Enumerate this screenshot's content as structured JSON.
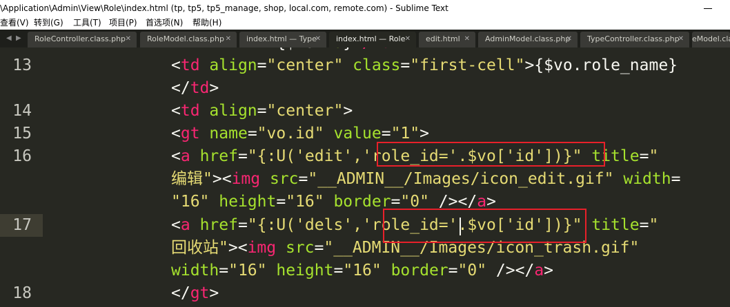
{
  "window": {
    "title": "\\Application\\Admin\\View\\Role\\index.html (tp, tp5, tp5_manage, shop, local.com, remote.com) - Sublime Text"
  },
  "menu": [
    "查看(V)",
    "转到(G)",
    "工具(T)",
    "项目(P)",
    "首选项(N)",
    "帮助(H)"
  ],
  "tabs": [
    {
      "label": "RoleController.class.php",
      "active": false
    },
    {
      "label": "RoleModel.class.php",
      "active": false
    },
    {
      "label": "index.html — Type",
      "active": false
    },
    {
      "label": "index.html — Role",
      "active": true
    },
    {
      "label": "edit.html",
      "active": false
    },
    {
      "label": "AdminModel.class.php",
      "active": false
    },
    {
      "label": "TypeController.class.php",
      "active": false
    },
    {
      "label": "eModel.cla",
      "active": false
    }
  ],
  "editor": {
    "line_numbers": [
      "13",
      "14",
      "15",
      "16",
      "17",
      "18"
    ],
    "current_line": "17",
    "lines": [
      [
        [
          "tg",
          "      <"
        ],
        [
          "tg",
          "tr"
        ],
        [
          "pl",
          "> {$vo."
        ],
        [
          "at",
          "id"
        ],
        [
          "pl",
          "}"
        ],
        [
          "tg",
          "</"
        ],
        [
          "tg",
          "td"
        ],
        [
          "pl",
          ">"
        ]
      ],
      [
        [
          "pl",
          "<"
        ],
        [
          "tg",
          "td"
        ],
        [
          "pl",
          " "
        ],
        [
          "at",
          "align"
        ],
        [
          "pl",
          "="
        ],
        [
          "st",
          "\"center\""
        ],
        [
          "pl",
          " "
        ],
        [
          "at",
          "class"
        ],
        [
          "pl",
          "="
        ],
        [
          "st",
          "\"first-cell\""
        ],
        [
          "pl",
          ">{$vo.role_name}"
        ]
      ],
      [
        [
          "pl",
          "</"
        ],
        [
          "tg",
          "td"
        ],
        [
          "pl",
          ">"
        ]
      ],
      [
        [
          "pl",
          "<"
        ],
        [
          "tg",
          "td"
        ],
        [
          "pl",
          " "
        ],
        [
          "at",
          "align"
        ],
        [
          "pl",
          "="
        ],
        [
          "st",
          "\"center\""
        ],
        [
          "pl",
          ">"
        ]
      ],
      [
        [
          "pl",
          "<"
        ],
        [
          "tg",
          "gt"
        ],
        [
          "pl",
          " "
        ],
        [
          "at",
          "name"
        ],
        [
          "pl",
          "="
        ],
        [
          "st",
          "\"vo.id\""
        ],
        [
          "pl",
          " "
        ],
        [
          "at",
          "value"
        ],
        [
          "pl",
          "="
        ],
        [
          "st",
          "\"1\""
        ],
        [
          "pl",
          ">"
        ]
      ],
      [
        [
          "pl",
          "<"
        ],
        [
          "tg",
          "a"
        ],
        [
          "pl",
          " "
        ],
        [
          "at",
          "href"
        ],
        [
          "pl",
          "="
        ],
        [
          "st",
          "\"{:U('edit','role_id='.$vo['id'])}\""
        ],
        [
          "pl",
          " "
        ],
        [
          "at",
          "title"
        ],
        [
          "pl",
          "="
        ],
        [
          "st",
          "\""
        ]
      ],
      [
        [
          "st",
          "编辑\""
        ],
        [
          "pl",
          "><"
        ],
        [
          "tg",
          "img"
        ],
        [
          "pl",
          " "
        ],
        [
          "at",
          "src"
        ],
        [
          "pl",
          "="
        ],
        [
          "st",
          "\"__ADMIN__/Images/icon_edit.gif\""
        ],
        [
          "pl",
          " "
        ],
        [
          "at",
          "width"
        ],
        [
          "pl",
          "="
        ]
      ],
      [
        [
          "st",
          "\"16\""
        ],
        [
          "pl",
          " "
        ],
        [
          "at",
          "height"
        ],
        [
          "pl",
          "="
        ],
        [
          "st",
          "\"16\""
        ],
        [
          "pl",
          " "
        ],
        [
          "at",
          "border"
        ],
        [
          "pl",
          "="
        ],
        [
          "st",
          "\"0\""
        ],
        [
          "pl",
          " /></"
        ],
        [
          "tg",
          "a"
        ],
        [
          "pl",
          ">"
        ]
      ],
      [
        [
          "pl",
          "<"
        ],
        [
          "tg",
          "a"
        ],
        [
          "pl",
          " "
        ],
        [
          "at",
          "href"
        ],
        [
          "pl",
          "="
        ],
        [
          "st",
          "\"{:U('dels','role_id='.$vo['id'])}\""
        ],
        [
          "pl",
          " "
        ],
        [
          "at",
          "title"
        ],
        [
          "pl",
          "="
        ],
        [
          "st",
          "\""
        ]
      ],
      [
        [
          "st",
          "回收站\""
        ],
        [
          "pl",
          "><"
        ],
        [
          "tg",
          "img"
        ],
        [
          "pl",
          " "
        ],
        [
          "at",
          "src"
        ],
        [
          "pl",
          "="
        ],
        [
          "st",
          "\"__ADMIN__/Images/icon_trash.gif\""
        ]
      ],
      [
        [
          "at",
          "width"
        ],
        [
          "pl",
          "="
        ],
        [
          "st",
          "\"16\""
        ],
        [
          "pl",
          " "
        ],
        [
          "at",
          "height"
        ],
        [
          "pl",
          "="
        ],
        [
          "st",
          "\"16\""
        ],
        [
          "pl",
          " "
        ],
        [
          "at",
          "border"
        ],
        [
          "pl",
          "="
        ],
        [
          "st",
          "\"0\""
        ],
        [
          "pl",
          " /></"
        ],
        [
          "tg",
          "a"
        ],
        [
          "pl",
          ">"
        ]
      ],
      [
        [
          "pl",
          "</"
        ],
        [
          "tg",
          "gt"
        ],
        [
          "pl",
          ">"
        ]
      ]
    ]
  },
  "colors": {
    "background": "#272822",
    "tag": "#f92672",
    "attribute": "#a6e22e",
    "string": "#e6db74",
    "annotation": "#e8202a"
  }
}
